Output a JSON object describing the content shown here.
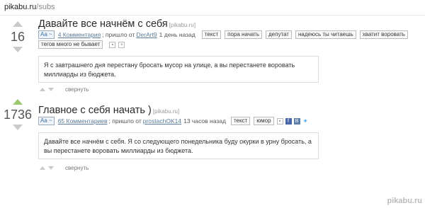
{
  "address_bar": {
    "host": "pikabu.ru",
    "path": "/subs"
  },
  "posts": [
    {
      "rating": "16",
      "title": "Давайте все начнём с себя",
      "source": "[pikabu.ru]",
      "aa": "Aa ~",
      "comments": "4 Комментария",
      "sent_by": "; пришло от",
      "author": "DerArt9",
      "time": "1 день назад",
      "tags": [
        "текст",
        "пора начать",
        "депутат",
        "надеюсь ты читаешь",
        "хватит воровать"
      ],
      "tags_row2": [
        "тегов много не бывает"
      ],
      "text": "Я с завтрашнего дня перестану бросать мусор на улице, а вы перестанете воровать миллиарды из бюджета.",
      "collapse": "свернуть"
    },
    {
      "rating": "1736",
      "title": "Главное с себя начать )",
      "source": "[pikabu.ru]",
      "aa": "Aa ~",
      "comments": "65 Комментариев",
      "sent_by": "; пришло от",
      "author": "prostachOK14",
      "time": "13 часов назад",
      "tags": [
        "текст",
        "юмор"
      ],
      "text": "Давайте все начнём с себя. Я со следующего понедельника буду окурки в урну бросать, а вы перестанете воровать миллиарды из бюджета.",
      "collapse": "свернуть"
    }
  ],
  "watermark": "pikabu.ru",
  "icons": [
    "save-icon",
    "plus-icon",
    "facebook-icon",
    "vk-icon",
    "twitter-icon"
  ],
  "colors": {
    "upvote_active": "#9bc96d",
    "link": "#5a7a99",
    "aa": "#3a6ea5"
  }
}
